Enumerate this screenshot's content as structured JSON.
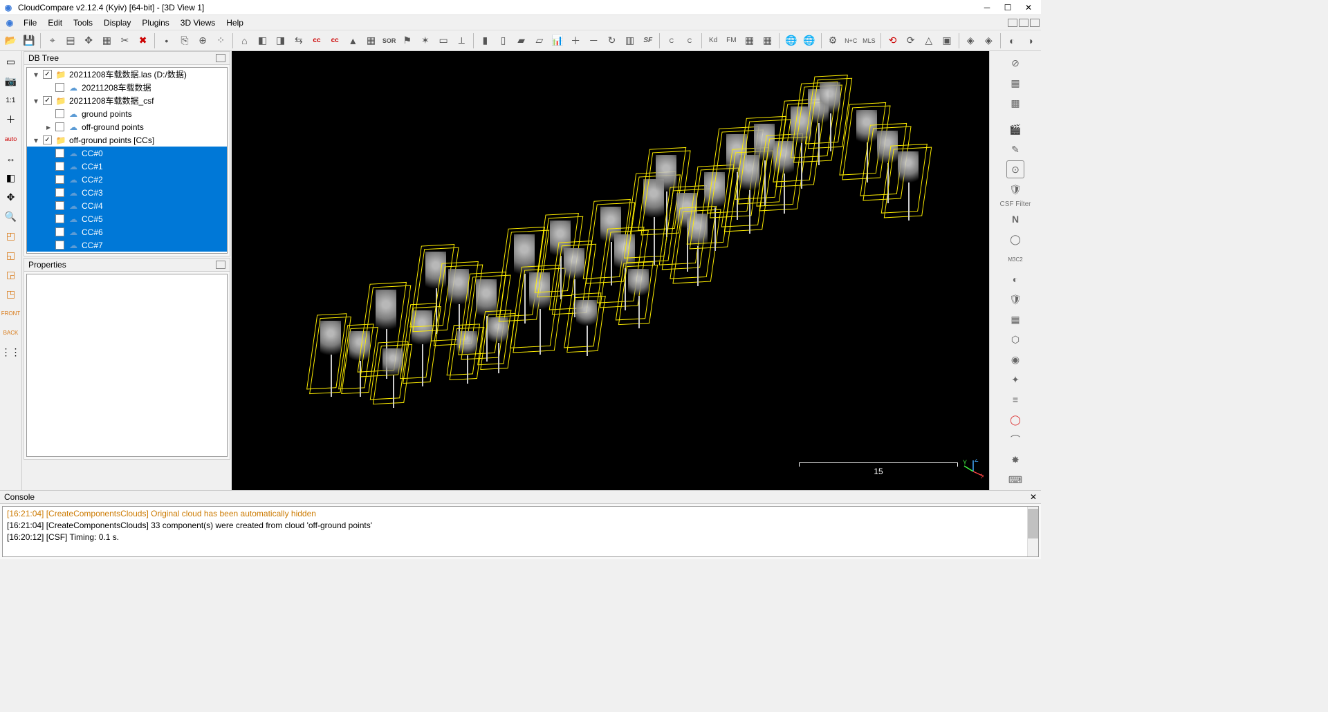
{
  "window": {
    "title": "CloudCompare v2.12.4 (Kyiv) [64-bit] - [3D View 1]"
  },
  "menu": {
    "items": [
      "File",
      "Edit",
      "Tools",
      "Display",
      "Plugins",
      "3D Views",
      "Help"
    ]
  },
  "panels": {
    "dbtree": {
      "title": "DB Tree"
    },
    "properties": {
      "title": "Properties"
    },
    "console": {
      "title": "Console"
    }
  },
  "tree": {
    "items": [
      {
        "indent": 0,
        "exp": "▾",
        "checked": true,
        "icon": "folder",
        "label": "20211208车载数据.las (D:/数据)"
      },
      {
        "indent": 1,
        "exp": "",
        "checked": false,
        "icon": "cloud",
        "label": "20211208车载数据"
      },
      {
        "indent": 0,
        "exp": "▾",
        "checked": true,
        "icon": "folder",
        "label": "20211208车载数据_csf"
      },
      {
        "indent": 1,
        "exp": "",
        "checked": false,
        "icon": "cloud",
        "label": "ground points"
      },
      {
        "indent": 1,
        "exp": "▸",
        "checked": false,
        "icon": "cloud",
        "label": "off-ground points"
      },
      {
        "indent": 0,
        "exp": "▾",
        "checked": true,
        "icon": "folder",
        "label": "off-ground points [CCs]",
        "sel": false
      },
      {
        "indent": 1,
        "exp": "",
        "checked": true,
        "icon": "cloud",
        "label": "CC#0",
        "sel": true
      },
      {
        "indent": 1,
        "exp": "",
        "checked": true,
        "icon": "cloud",
        "label": "CC#1",
        "sel": true
      },
      {
        "indent": 1,
        "exp": "",
        "checked": true,
        "icon": "cloud",
        "label": "CC#2",
        "sel": true
      },
      {
        "indent": 1,
        "exp": "",
        "checked": true,
        "icon": "cloud",
        "label": "CC#3",
        "sel": true
      },
      {
        "indent": 1,
        "exp": "",
        "checked": true,
        "icon": "cloud",
        "label": "CC#4",
        "sel": true
      },
      {
        "indent": 1,
        "exp": "",
        "checked": true,
        "icon": "cloud",
        "label": "CC#5",
        "sel": true
      },
      {
        "indent": 1,
        "exp": "",
        "checked": true,
        "icon": "cloud",
        "label": "CC#6",
        "sel": true
      },
      {
        "indent": 1,
        "exp": "",
        "checked": true,
        "icon": "cloud",
        "label": "CC#7",
        "sel": true
      }
    ]
  },
  "console": {
    "lines": [
      {
        "text": "[16:20:12] [CSF] Timing: 0.1 s.",
        "warn": false
      },
      {
        "text": "[16:21:04] [CreateComponentsClouds] 33 component(s) were created from cloud 'off-ground points'",
        "warn": false
      },
      {
        "text": "[16:21:04] [CreateComponentsClouds] Original cloud has been automatically hidden",
        "warn": true
      }
    ]
  },
  "viewport": {
    "scale_label": "15",
    "axes": {
      "x": "X",
      "y": "Y",
      "z": "Z"
    }
  },
  "right_labels": {
    "csf": "CSF Filter",
    "n": "N"
  },
  "toolbar_icons": {
    "open": "📂",
    "save": "💾",
    "pick": "⌖",
    "level": "▤",
    "translate": "✥",
    "segment": "▦",
    "cross": "✂",
    "delete": "✖",
    "pointlist": "•",
    "clone": "⎘",
    "merge": "⊕",
    "subsample": "⁘",
    "fit": "⌂",
    "register": "◧",
    "align": "◨",
    "pair": "⇆",
    "cc": "cc",
    "cc2": "cc",
    "prim": "▲",
    "rasterize": "▦",
    "sor": "SOR",
    "label": "⚑",
    "gblsensor": "✶",
    "cam": "▭",
    "scale": "⟂",
    "histo": "▮",
    "val2sf": "▯",
    "grad": "▰",
    "filter": "▱",
    "arith": "📊",
    "plus": "＋",
    "minus": "－",
    "convert": "↻",
    "sfpal": "▥",
    "sf": "SF",
    "canupo1": "C",
    "canupo2": "C",
    "kd": "Kd",
    "fm": "FM",
    "raster": "▦",
    "csv": "▦",
    "globe1": "🌐",
    "globe2": "🌐",
    "gear": "⚙",
    "nc": "N+C",
    "mls": "MLS",
    "seg2": "⟲",
    "hull": "⟳",
    "mesh": "△",
    "clip": "▣"
  }
}
